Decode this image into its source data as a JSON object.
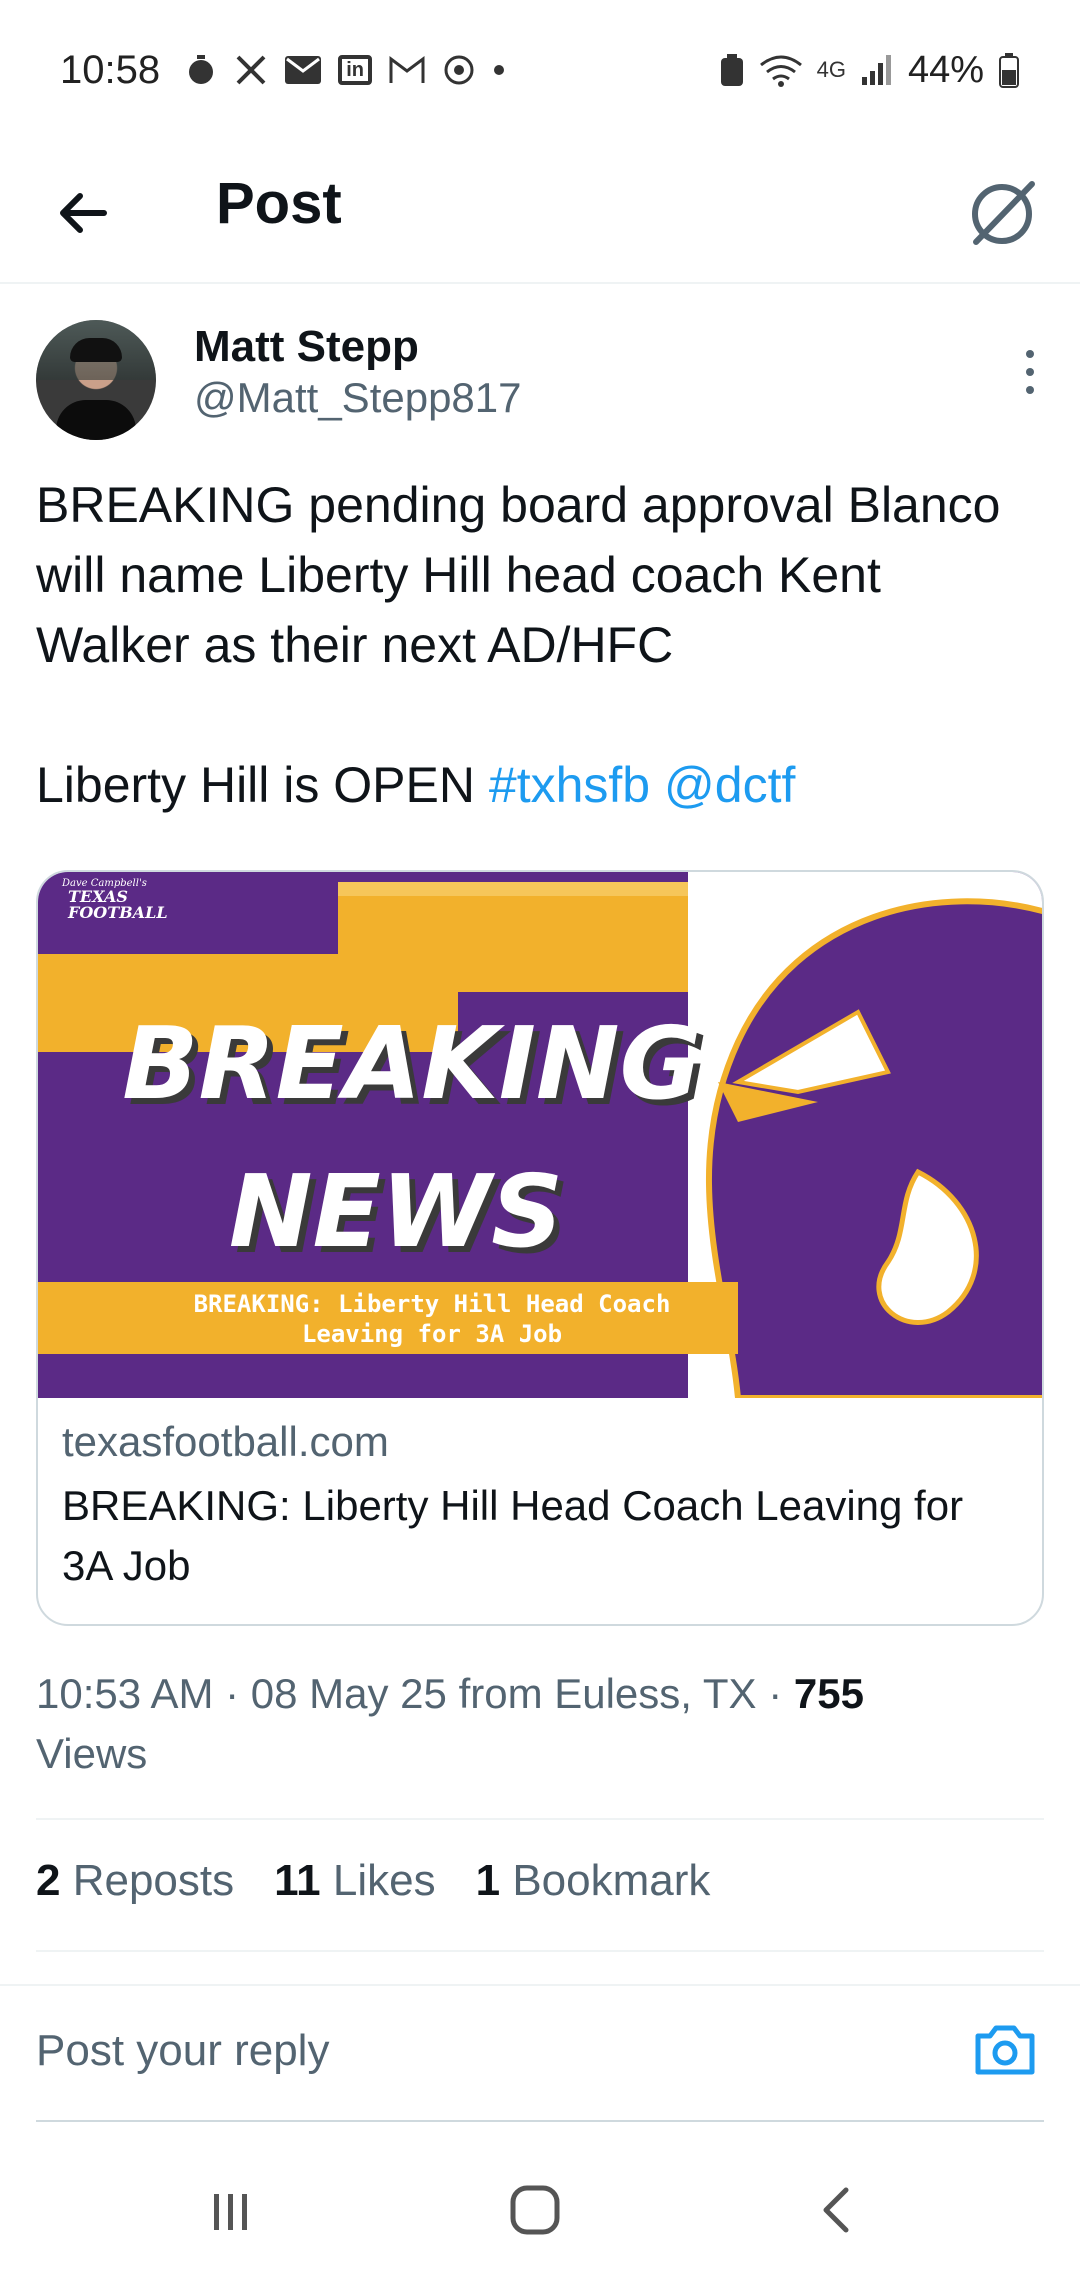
{
  "status_bar": {
    "time": "10:58",
    "network": "4G",
    "battery": "44%"
  },
  "header": {
    "title": "Post"
  },
  "post": {
    "author_name": "Matt Stepp",
    "author_handle": "@Matt_Stepp817",
    "text_line1": "BREAKING pending board approval Blanco will name Liberty Hill head coach Kent Walker as their next AD/HFC",
    "text_line2_prefix": "Liberty Hill is OPEN ",
    "hashtag": "#txhsfb",
    "mention": "@dctf",
    "card": {
      "image_brand_small": "Dave Campbell's",
      "image_brand": "TEXAS",
      "image_brand2": "FOOTBALL",
      "image_headline1": "BREAKING",
      "image_headline2": "NEWS",
      "image_caption1": "BREAKING: Liberty Hill Head Coach",
      "image_caption2": "Leaving for 3A Job",
      "domain": "texasfootball.com",
      "title": "BREAKING: Liberty Hill Head Coach Leaving for 3A Job"
    },
    "timestamp": "10:53 AM · 08 May 25 from Euless, TX · ",
    "views_count": "755",
    "views_label": "Views",
    "stats": {
      "reposts_count": "2",
      "reposts_label": "Reposts",
      "likes_count": "11",
      "likes_label": "Likes",
      "bookmarks_count": "1",
      "bookmarks_label": "Bookmark"
    }
  },
  "reply": {
    "placeholder": "Post your reply"
  },
  "colors": {
    "link": "#1d9bf0",
    "purple": "#5b2a86",
    "gold": "#f2b12c"
  }
}
